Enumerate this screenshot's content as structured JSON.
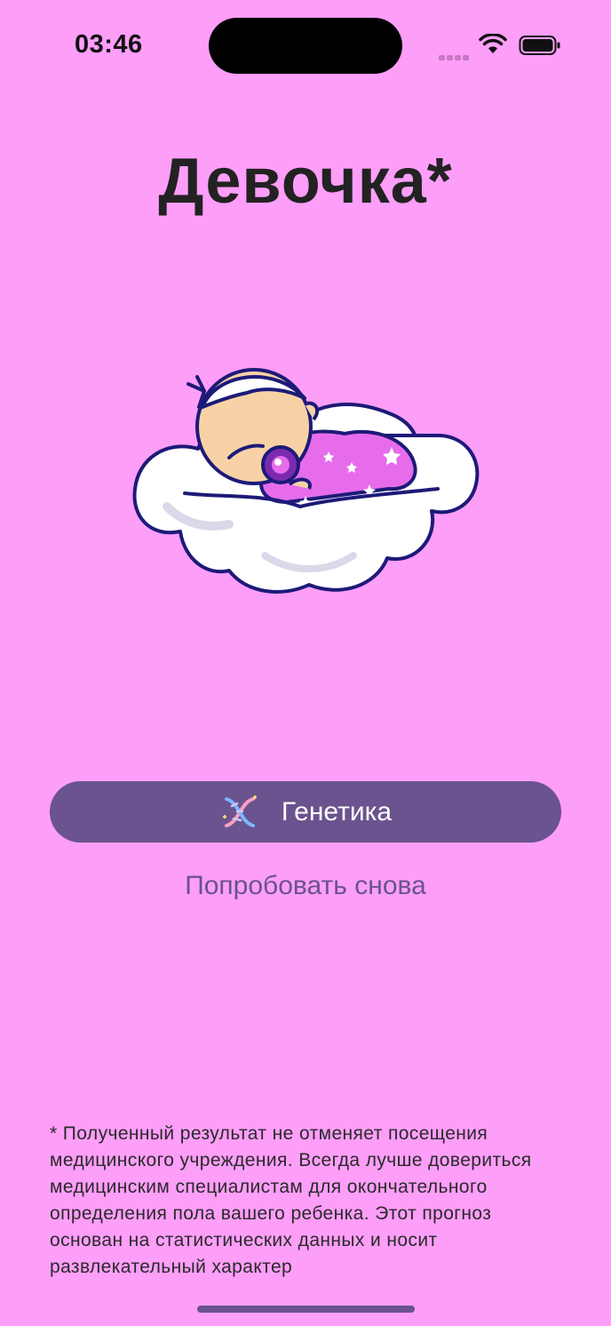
{
  "status_bar": {
    "time": "03:46"
  },
  "result": {
    "title": "Девочка*"
  },
  "illustration": {
    "name": "sleeping-baby-on-cloud"
  },
  "actions": {
    "genetics_label": "Генетика",
    "retry_label": "Попробовать снова"
  },
  "disclaimer": {
    "text": "* Полученный результат не отменяет посещения медицинского учреждения. Всегда лучше довериться медицинским специалистам для окончательного определения пола вашего ребенка. Этот прогноз основан на статистических данных и носит развлекательный характер"
  },
  "colors": {
    "background": "#FD9EF9",
    "button": "#6A538E",
    "link": "#6A538E"
  }
}
